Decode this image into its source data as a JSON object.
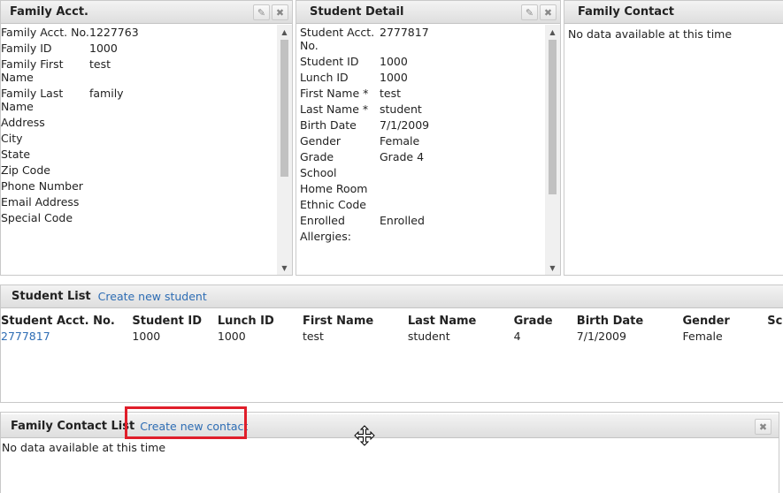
{
  "family_acct": {
    "title": "Family Acct.",
    "fields": [
      {
        "label": "Family Acct. No.",
        "value": "1227763"
      },
      {
        "label": "Family ID",
        "value": "1000"
      },
      {
        "label": "Family First Name",
        "value": "test"
      },
      {
        "label": "Family Last Name",
        "value": "family"
      },
      {
        "label": "Address",
        "value": ""
      },
      {
        "label": "City",
        "value": ""
      },
      {
        "label": "State",
        "value": ""
      },
      {
        "label": "Zip Code",
        "value": ""
      },
      {
        "label": "Phone Number",
        "value": ""
      },
      {
        "label": "Email Address",
        "value": ""
      },
      {
        "label": "Special Code",
        "value": ""
      }
    ]
  },
  "student_detail": {
    "title": "Student Detail",
    "fields": [
      {
        "label": "Student Acct. No.",
        "value": "2777817"
      },
      {
        "label": "Student ID",
        "value": "1000"
      },
      {
        "label": "Lunch ID",
        "value": "1000"
      },
      {
        "label": "First Name *",
        "value": "test"
      },
      {
        "label": "Last Name *",
        "value": "student"
      },
      {
        "label": "Birth Date",
        "value": "7/1/2009"
      },
      {
        "label": "Gender",
        "value": "Female"
      },
      {
        "label": "Grade",
        "value": "Grade 4"
      },
      {
        "label": "School",
        "value": ""
      },
      {
        "label": "Home Room",
        "value": ""
      },
      {
        "label": "Ethnic Code",
        "value": ""
      },
      {
        "label": "Enrolled",
        "value": "Enrolled"
      },
      {
        "label": "Allergies:",
        "value": ""
      }
    ]
  },
  "family_contact": {
    "title": "Family Contact",
    "empty_text": "No data available at this time"
  },
  "student_list": {
    "title": "Student List",
    "create_link": "Create new student",
    "columns": [
      "Student Acct. No.",
      "Student ID",
      "Lunch ID",
      "First Name",
      "Last Name",
      "Grade",
      "Birth Date",
      "Gender",
      "Sc"
    ],
    "rows": [
      [
        "2777817",
        "1000",
        "1000",
        "test",
        "student",
        "4",
        "7/1/2009",
        "Female",
        ""
      ]
    ]
  },
  "family_contact_list": {
    "title": "Family Contact List",
    "create_link": "Create new contact",
    "empty_text": "No data available at this time"
  },
  "colors": {
    "link": "#2e6db4",
    "highlight": "#e01e2a"
  },
  "icons": {
    "edit": "pencil-icon",
    "close": "close-icon",
    "move": "move-cursor-icon"
  }
}
